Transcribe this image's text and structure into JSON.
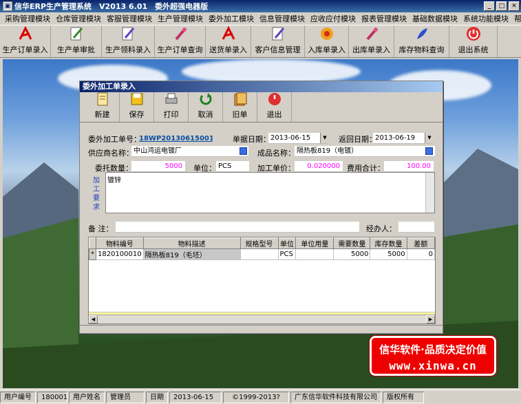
{
  "window": {
    "title": "信华ERP生产管理系统　V2013 6.01　委外超强电器版",
    "app_icon": "app-icon"
  },
  "menu": [
    "采购管理模块",
    "仓库管理模块",
    "客服管理模块",
    "生产管理模块",
    "委外加工模块",
    "信息管理模块",
    "应收应付模块",
    "报表管理模块",
    "基础数据模块",
    "系统功能模块",
    "帮助"
  ],
  "toolbar": [
    {
      "label": "生产订单录入",
      "icon": "acrobat-icon"
    },
    {
      "label": "生产单审批",
      "icon": "pencil-icon"
    },
    {
      "label": "生产领料录入",
      "icon": "pen-icon"
    },
    {
      "label": "生产订单查询",
      "icon": "brush-icon"
    },
    {
      "label": "送货单录入",
      "icon": "acrobat-icon"
    },
    {
      "label": "客户信息管理",
      "icon": "pen-icon"
    },
    {
      "label": "入库单录入",
      "icon": "flower-icon"
    },
    {
      "label": "出库单录入",
      "icon": "brush-icon"
    },
    {
      "label": "库存物料查询",
      "icon": "feather-icon"
    },
    {
      "label": "退出系统",
      "icon": "power-icon"
    }
  ],
  "dialog": {
    "title": "委外加工单录入",
    "toolbar": [
      {
        "label": "新建",
        "icon": "new-doc-icon"
      },
      {
        "label": "保存",
        "icon": "save-icon"
      },
      {
        "label": "打印",
        "icon": "print-icon"
      },
      {
        "label": "取消",
        "icon": "cancel-icon"
      },
      {
        "label": "旧单",
        "icon": "old-order-icon"
      },
      {
        "label": "退出",
        "icon": "exit-icon"
      }
    ],
    "form": {
      "order_no_label": "委外加工单号：",
      "order_no": "18WP20130615001",
      "doc_date_label": "单据日期：",
      "doc_date": "2013-06-15",
      "return_date_label": "返回日期：",
      "return_date": "2013-06-19",
      "supplier_label": "供应商名称：",
      "supplier": "中山鸿运电镀厂",
      "product_label": "成品名称：",
      "product": "隔热板819（电镀）",
      "qty_label": "委托数量：",
      "qty": "5000",
      "unit_label": "单位：",
      "unit": "PCS",
      "price_label": "加工单价：",
      "price": "0.020000",
      "total_label": "费用合计：",
      "total": "100.00",
      "req_label": "加工要求",
      "req_value": "镀锌",
      "remark_label": "备 注：",
      "handler_label": "经办人："
    },
    "grid": {
      "headers": [
        "物料编号",
        "物料描述",
        "规格型号",
        "单位",
        "单位用量",
        "需要数量",
        "库存数量",
        "差额"
      ],
      "rows": [
        {
          "indicator": "*",
          "code": "1820100010",
          "desc": "隔热板819（毛坯）",
          "spec": "",
          "unit": "PCS",
          "usage": "",
          "need": "5000",
          "stock": "5000",
          "diff": "0"
        }
      ]
    }
  },
  "badge": {
    "line1": "信华软件·品质决定价值",
    "line2": "www.xinwa.cn"
  },
  "status": [
    {
      "label": "用户编号",
      "value": "180001"
    },
    {
      "label": "用户姓名",
      "value": "管理员"
    },
    {
      "label": "日期",
      "value": "2013-06-15"
    }
  ],
  "copyright": "©1999-2013?",
  "company": "广东信华软件科技有限公司",
  "rights": "版权所有"
}
